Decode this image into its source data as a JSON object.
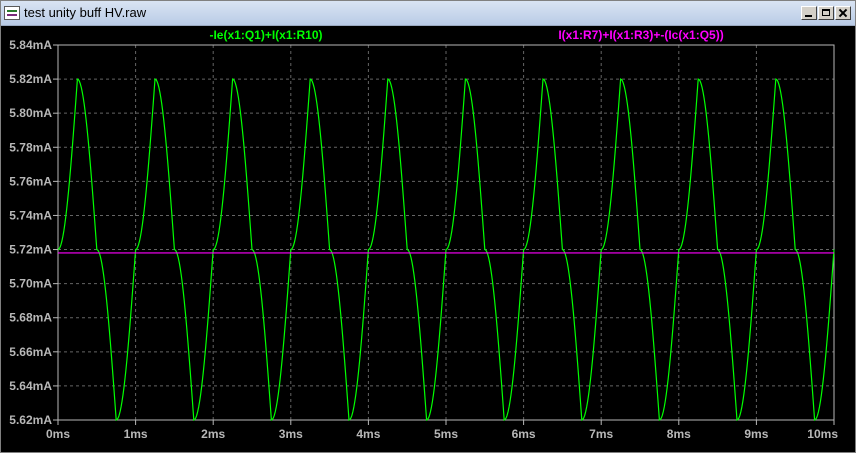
{
  "window": {
    "title": "test unity buff HV.raw",
    "controls": [
      "minimize",
      "maximize",
      "close"
    ],
    "icon": "waveform-app-icon"
  },
  "chart_data": {
    "type": "line",
    "title": "",
    "xlabel": "",
    "ylabel": "",
    "xlim": [
      0,
      10
    ],
    "ylim": [
      5.62,
      5.84
    ],
    "x_unit": "ms",
    "y_unit": "mA",
    "grid": true,
    "legend_placement": "top",
    "background": "#000000",
    "axis_color": "#b8b8b8",
    "x_ticks": [
      "0ms",
      "1ms",
      "2ms",
      "3ms",
      "4ms",
      "5ms",
      "6ms",
      "7ms",
      "8ms",
      "9ms",
      "10ms"
    ],
    "y_ticks": [
      "5.62mA",
      "5.64mA",
      "5.66mA",
      "5.68mA",
      "5.70mA",
      "5.72mA",
      "5.74mA",
      "5.76mA",
      "5.78mA",
      "5.80mA",
      "5.82mA",
      "5.84mA"
    ],
    "series": [
      {
        "name": "-Ie(x1:Q1)+I(x1:R10)",
        "color": "#00ff00",
        "x": [
          0,
          0.25,
          0.5,
          0.75,
          1,
          1.25,
          1.5,
          1.75,
          2,
          2.25,
          2.5,
          2.75,
          3,
          3.25,
          3.5,
          3.75,
          4,
          4.25,
          4.5,
          4.75,
          5,
          5.25,
          5.5,
          5.75,
          6,
          6.25,
          6.5,
          6.75,
          7,
          7.25,
          7.5,
          7.75,
          8,
          8.25,
          8.5,
          8.75,
          9,
          9.25,
          9.5,
          9.75,
          10
        ],
        "y": [
          5.72,
          5.82,
          5.72,
          5.62,
          5.72,
          5.82,
          5.72,
          5.62,
          5.72,
          5.82,
          5.72,
          5.62,
          5.72,
          5.82,
          5.72,
          5.62,
          5.72,
          5.82,
          5.72,
          5.62,
          5.72,
          5.82,
          5.72,
          5.62,
          5.72,
          5.82,
          5.72,
          5.62,
          5.72,
          5.82,
          5.72,
          5.62,
          5.72,
          5.82,
          5.72,
          5.62,
          5.72,
          5.82,
          5.72,
          5.62,
          5.72
        ]
      },
      {
        "name": "I(x1:R7)+I(x1:R3)+-(Ic(x1:Q5))",
        "color": "#ff00ff",
        "x": [
          0,
          10
        ],
        "y": [
          5.718,
          5.718
        ]
      }
    ]
  }
}
